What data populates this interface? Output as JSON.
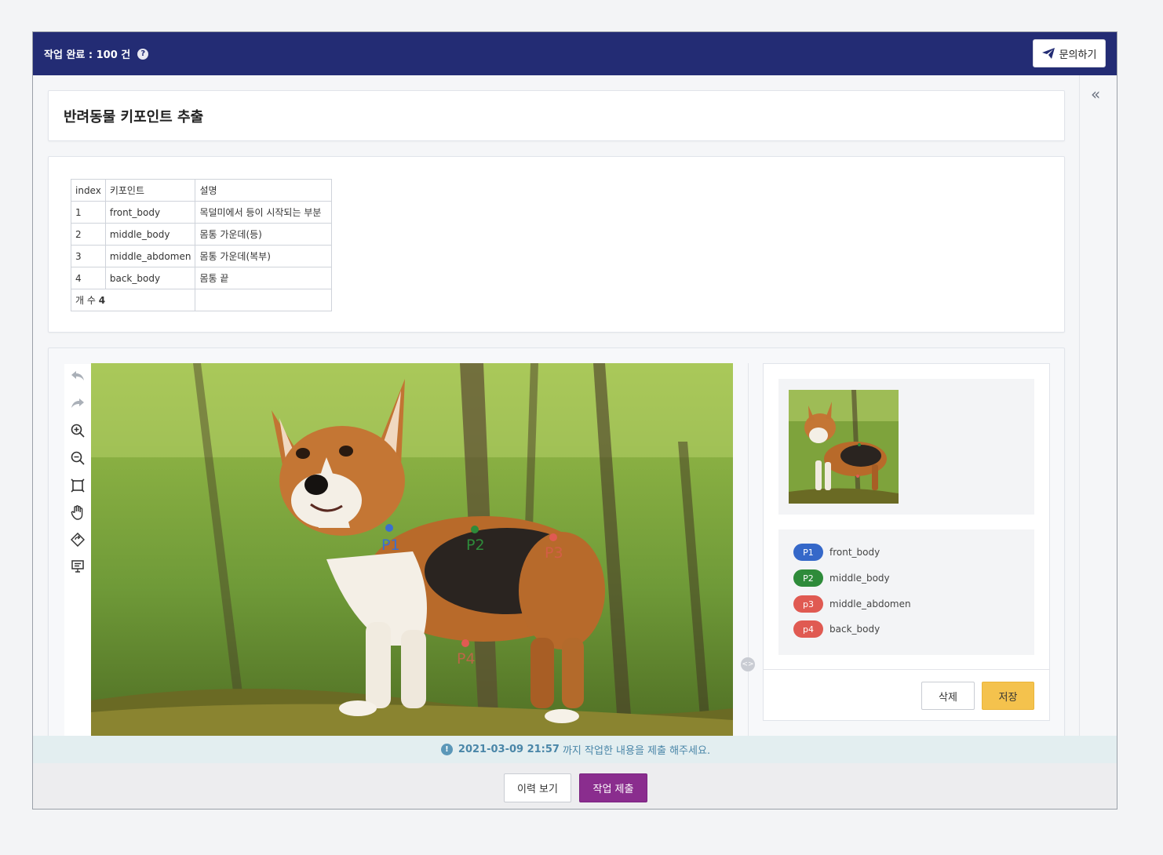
{
  "header": {
    "status_text": "작업 완료 : 100 건",
    "help_icon": "?",
    "inquiry_label": "문의하기"
  },
  "title": "반려동물 키포인트 추출",
  "collapse_icon": "«",
  "keypoint_table": {
    "headers": [
      "index",
      "키포인트",
      "설명"
    ],
    "rows": [
      [
        "1",
        "front_body",
        "목덜미에서 등이 시작되는 부분"
      ],
      [
        "2",
        "middle_body",
        "몸통 가운데(등)"
      ],
      [
        "3",
        "middle_abdomen",
        "몸통 가운데(복부)"
      ],
      [
        "4",
        "back_body",
        "몸통 끝"
      ]
    ],
    "count_label": "개 수",
    "count_value": "4"
  },
  "toolbar": {
    "tools": [
      "undo-icon",
      "redo-icon",
      "zoom-in-icon",
      "zoom-out-icon",
      "fit-screen-icon",
      "pan-hand-icon",
      "reset-rotate-icon",
      "presentation-icon"
    ]
  },
  "canvas_points": [
    {
      "label": "P1",
      "color": "#3a6fd0"
    },
    {
      "label": "P2",
      "color": "#2e8b3a"
    },
    {
      "label": "P3",
      "color": "#e05a52"
    },
    {
      "label": "P4",
      "color": "#e05a52"
    }
  ],
  "legend": [
    {
      "badge": "P1",
      "name": "front_body",
      "color": "#3568c9"
    },
    {
      "badge": "P2",
      "name": "middle_body",
      "color": "#2e8b3a"
    },
    {
      "badge": "p3",
      "name": "middle_abdomen",
      "color": "#e05a52"
    },
    {
      "badge": "p4",
      "name": "back_body",
      "color": "#e05a52"
    }
  ],
  "panel_buttons": {
    "delete": "삭제",
    "save": "저장"
  },
  "deadline": {
    "date": "2021-03-09 21:57",
    "suffix": "까지 작업한 내용을 제출 해주세요."
  },
  "footer": {
    "history": "이력 보기",
    "submit": "작업 제출"
  }
}
